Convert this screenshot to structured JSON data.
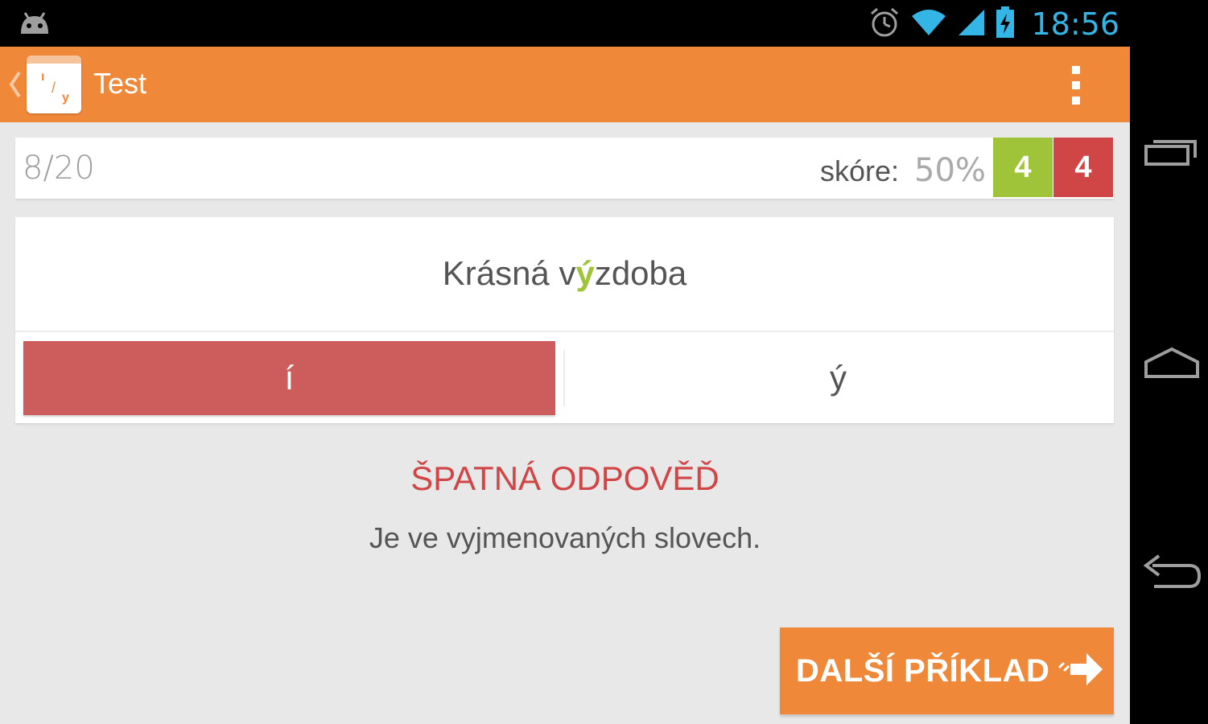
{
  "status_bar": {
    "time": "18:56",
    "icons": [
      "android-icon",
      "alarm-icon",
      "wifi-icon",
      "signal-icon",
      "battery-charging-icon"
    ]
  },
  "action_bar": {
    "title": "Test",
    "app_icon": "app-icon",
    "overflow_icon": "overflow-menu-icon",
    "color": "#f0883a"
  },
  "score": {
    "progress": "8/20",
    "label": "skóre:",
    "value": "50%",
    "correct_count": "4",
    "wrong_count": "4",
    "correct_color": "#9fc43a",
    "wrong_color": "#d04545"
  },
  "question": {
    "before": "Krásná v",
    "highlight": "ý",
    "after": "zdoba",
    "choices": [
      "í",
      "ý"
    ],
    "selected_wrong_color": "#cd5c5c"
  },
  "feedback": {
    "title": "ŠPATNÁ ODPOVĚĎ",
    "text": "Je ve vyjmenovaných slovech."
  },
  "next_button": {
    "label": "DALŠÍ PŘÍKLAD",
    "icon": "arrow-right-icon"
  },
  "nav_bar": {
    "icons": [
      "recent-apps-icon",
      "home-icon",
      "back-icon"
    ]
  }
}
